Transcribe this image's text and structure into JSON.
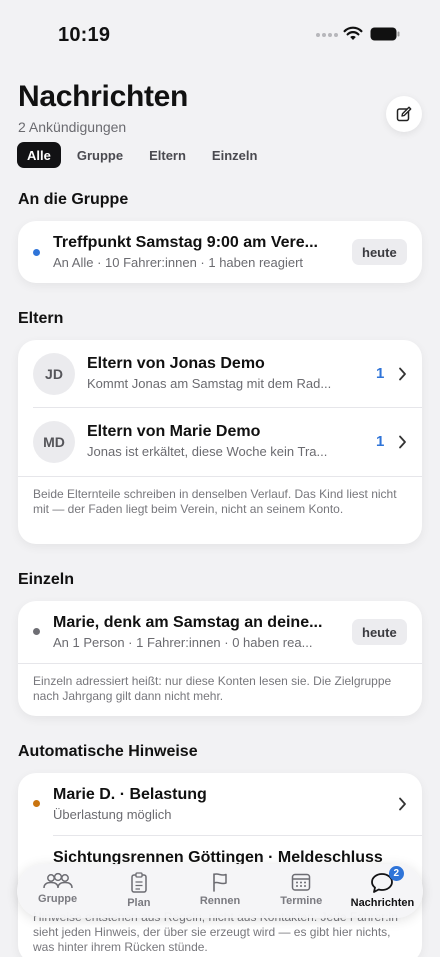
{
  "status_bar": {
    "time": "10:19"
  },
  "header": {
    "title": "Nachrichten",
    "subtitle": "2 Ankündigungen",
    "compose_icon": "compose-icon"
  },
  "filters": [
    {
      "label": "Alle",
      "active": true
    },
    {
      "label": "Gruppe",
      "active": false
    },
    {
      "label": "Eltern",
      "active": false
    },
    {
      "label": "Einzeln",
      "active": false
    }
  ],
  "sections": {
    "group": {
      "title": "An die Gruppe",
      "item": {
        "title": "Treffpunkt Samstag 9:00 am Vere...",
        "subtitle": "An Alle · 10 Fahrer:innen · 1 haben reagiert",
        "badge": "heute",
        "dot_color": "#2f74d8"
      }
    },
    "parents": {
      "title": "Eltern",
      "items": [
        {
          "initials": "JD",
          "title": "Eltern von Jonas Demo",
          "subtitle": "Kommt Jonas am Samstag mit dem Rad...",
          "count": "1"
        },
        {
          "initials": "MD",
          "title": "Eltern von Marie Demo",
          "subtitle": "Jonas ist erkältet, diese Woche kein Tra...",
          "count": "1"
        }
      ],
      "footnote": "Beide Elternteile schreiben in denselben Verlauf. Das Kind liest nicht mit — der Faden liegt beim Verein, nicht an seinem Konto."
    },
    "single": {
      "title": "Einzeln",
      "item": {
        "title": "Marie, denk am Samstag an deine...",
        "subtitle": "An 1 Person · 1 Fahrer:innen · 0 haben rea...",
        "badge": "heute",
        "dot_color": "#6e6e74"
      },
      "footnote": "Einzeln adressiert heißt: nur diese Konten lesen sie. Die Zielgruppe nach Jahrgang gilt dann nicht mehr."
    },
    "auto": {
      "title": "Automatische Hinweise",
      "items": [
        {
          "title": "Marie D. · Belastung",
          "subtitle": "Überlastung möglich",
          "dot_color": "#c9740f"
        },
        {
          "title": "Sichtungsrennen Göttingen · Meldeschluss"
        }
      ],
      "footnote": "Hinweise entstehen aus Regeln, nicht aus Kontakten. Jede Fahrer:in sieht jeden Hinweis, der über sie erzeugt wird — es gibt hier nichts, was hinter ihrem Rücken stünde."
    }
  },
  "tab_bar": {
    "items": [
      {
        "label": "Gruppe",
        "icon": "group-icon",
        "active": false
      },
      {
        "label": "Plan",
        "icon": "clipboard-icon",
        "active": false
      },
      {
        "label": "Rennen",
        "icon": "flag-icon",
        "active": false
      },
      {
        "label": "Termine",
        "icon": "calendar-icon",
        "active": false
      },
      {
        "label": "Nachrichten",
        "icon": "chat-bubble-icon",
        "active": true,
        "badge": "2"
      }
    ]
  },
  "colors": {
    "accent": "#2f74d8",
    "warning_dot": "#c9740f",
    "background": "#f2f2f4"
  }
}
